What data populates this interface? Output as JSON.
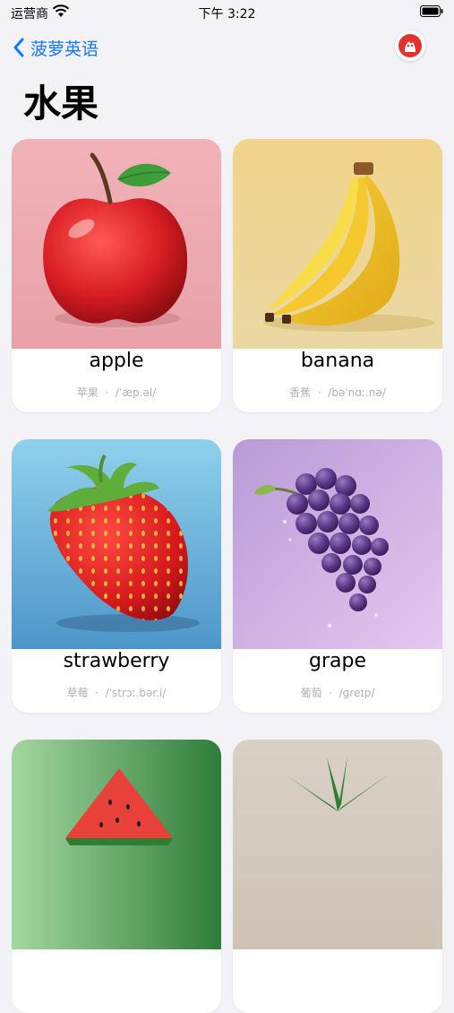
{
  "status": {
    "carrier": "运营商",
    "time": "下午 3:22"
  },
  "nav": {
    "back_label": "菠萝英语"
  },
  "page_title": "水果",
  "cards": [
    {
      "word": "apple",
      "meaning": "苹果",
      "phonetic": "ˈæp.əl"
    },
    {
      "word": "banana",
      "meaning": "香蕉",
      "phonetic": "bəˈnɑː.nə"
    },
    {
      "word": "strawberry",
      "meaning": "草莓",
      "phonetic": "ˈstrɔː.bər.i"
    },
    {
      "word": "grape",
      "meaning": "葡萄",
      "phonetic": "ɡreɪp"
    },
    {
      "word": "",
      "meaning": "",
      "phonetic": ""
    },
    {
      "word": "",
      "meaning": "",
      "phonetic": ""
    }
  ]
}
